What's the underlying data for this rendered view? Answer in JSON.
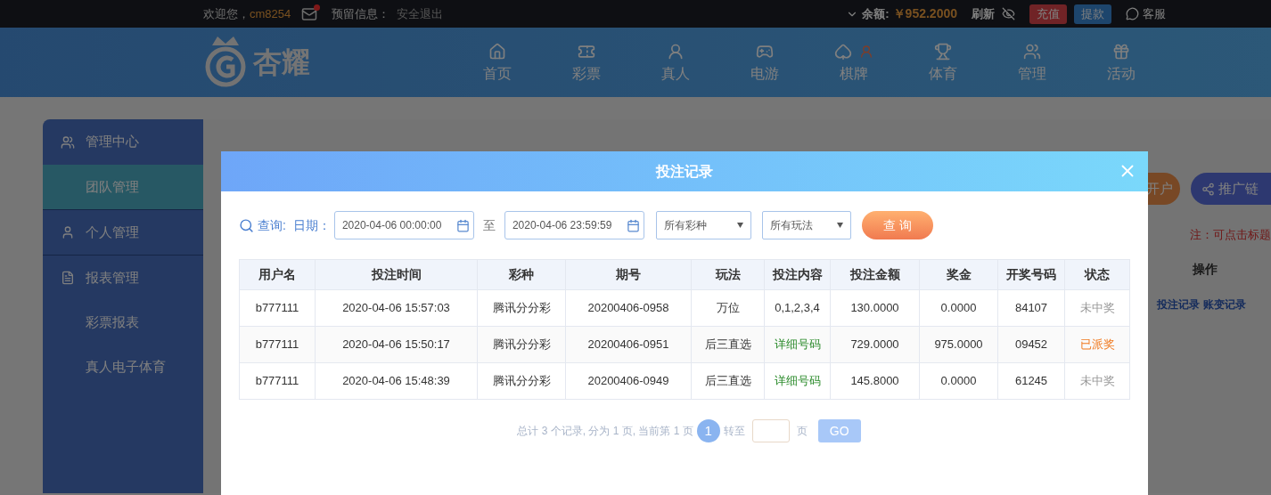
{
  "top_bar": {
    "welcome": "欢迎您，",
    "username": "cm8254",
    "mail_unread": true,
    "reserved_info": "预留信息：",
    "logout": "安全退出",
    "balance_label": "余额:",
    "balance": "￥952.2000",
    "refresh": "刷新",
    "deposit": "充值",
    "withdraw": "提款",
    "service": "客服"
  },
  "nav": {
    "logo": "杏耀",
    "items": [
      {
        "label": "首页",
        "kind": "home"
      },
      {
        "label": "彩票",
        "kind": "ticket"
      },
      {
        "label": "真人",
        "kind": "live"
      },
      {
        "label": "电游",
        "kind": "slot"
      },
      {
        "label": "棋牌",
        "kind": "cards"
      },
      {
        "label": "体育",
        "kind": "sport"
      },
      {
        "label": "管理",
        "kind": "manage"
      },
      {
        "label": "活动",
        "kind": "gift"
      }
    ]
  },
  "sidebar": {
    "sections": [
      {
        "label": "管理中心",
        "kind": "team",
        "children": [
          {
            "label": "团队管理",
            "selected": true
          }
        ]
      },
      {
        "label": "个人管理",
        "kind": "person"
      },
      {
        "label": "报表管理",
        "kind": "report",
        "children": [
          {
            "label": "彩票报表",
            "selected": false
          },
          {
            "label": "真人电子体育",
            "selected": false
          }
        ]
      }
    ]
  },
  "page": {
    "open_account": "开户",
    "promo_link": "推广链",
    "note": "注：可点击标题",
    "column_header": "操作",
    "links": [
      "投注记录",
      "账变记录"
    ]
  },
  "modal": {
    "title": "投注记录",
    "query_label": "查询:",
    "date_label": "日期：",
    "date_from": "2020-04-06 00:00:00",
    "to": "至",
    "date_to": "2020-04-06 23:59:59",
    "lottery_select": "所有彩种",
    "play_select": "所有玩法",
    "query_button": "查 询",
    "table": {
      "columns": [
        "用户名",
        "投注时间",
        "彩种",
        "期号",
        "玩法",
        "投注内容",
        "投注金额",
        "奖金",
        "开奖号码",
        "状态"
      ],
      "rows": [
        {
          "cells": [
            "b777111",
            "2020-04-06 15:57:03",
            "腾讯分分彩",
            "20200406-0958",
            "万位"
          ],
          "content": {
            "text": "0,1,2,3,4",
            "kind": "plain"
          },
          "amount": "130.0000",
          "prize": "0.0000",
          "number": "84107",
          "status": {
            "text": "未中奖",
            "kind": "lost"
          }
        },
        {
          "cells": [
            "b777111",
            "2020-04-06 15:50:17",
            "腾讯分分彩",
            "20200406-0951",
            "后三直选"
          ],
          "content": {
            "text": "详细号码",
            "kind": "link"
          },
          "amount": "729.0000",
          "prize": "975.0000",
          "number": "09452",
          "status": {
            "text": "已派奖",
            "kind": "paid"
          }
        },
        {
          "cells": [
            "b777111",
            "2020-04-06 15:48:39",
            "腾讯分分彩",
            "20200406-0949",
            "后三直选"
          ],
          "content": {
            "text": "详细号码",
            "kind": "link"
          },
          "amount": "145.8000",
          "prize": "0.0000",
          "number": "61245",
          "status": {
            "text": "未中奖",
            "kind": "lost"
          }
        }
      ]
    },
    "pagination": {
      "summary": "总计 3 个记录, 分为 1 页, 当前第 1 页",
      "pages": [
        {
          "label": "1",
          "selected": true
        }
      ],
      "goto": "转至",
      "page_unit": "页",
      "go": "GO"
    }
  }
}
